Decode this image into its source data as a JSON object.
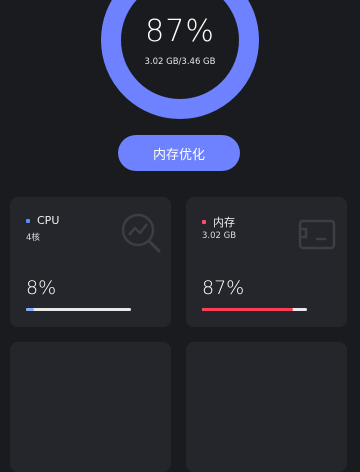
{
  "memory_ring": {
    "percent_text": "87%",
    "usage_text": "3.02 GB/3.46 GB",
    "ring_color": "#6e82ff"
  },
  "optimize_button": {
    "label": "内存优化",
    "color": "#6e82ff"
  },
  "cards": [
    {
      "title": "CPU",
      "subtitle": "4核",
      "percent_text": "8%",
      "fill": 0.08,
      "dot_color": "#5b8cff",
      "bar_color": "#7fb0ff",
      "icon": "chart-search-icon"
    },
    {
      "title": "内存",
      "subtitle": "3.02 GB",
      "percent_text": "87%",
      "fill": 0.87,
      "dot_color": "#ff4d6d",
      "bar_color": "#ff3d57",
      "icon": "memory-card-icon"
    }
  ]
}
